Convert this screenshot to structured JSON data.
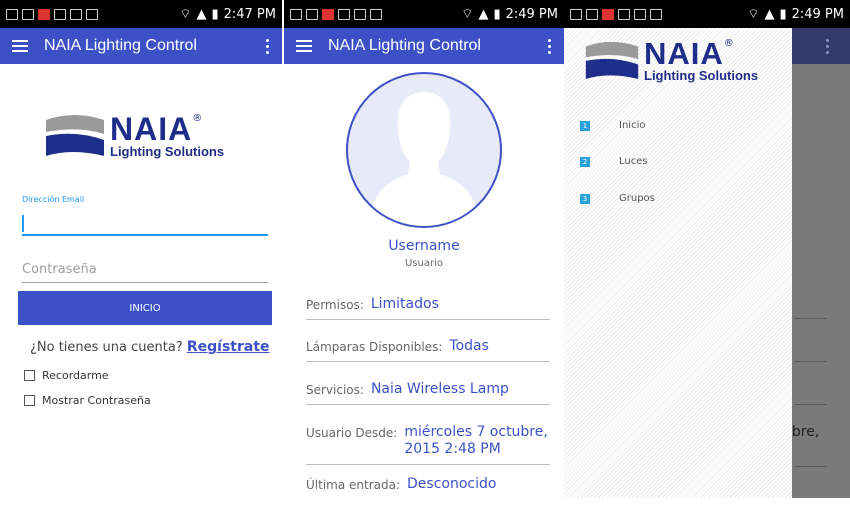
{
  "status": [
    {
      "time": "2:47 PM"
    },
    {
      "time": "2:49 PM"
    },
    {
      "time": "2:49 PM"
    }
  ],
  "appbar": {
    "title": "NAIA Lighting Control"
  },
  "logo": {
    "name": "NAIA",
    "tagline": "Lighting Solutions",
    "registered": "®"
  },
  "login": {
    "email_label": "Dirección Email",
    "email_value": "",
    "password_placeholder": "Contraseña",
    "submit_label": "INICIO",
    "signup_prompt": "¿No tienes una cuenta?",
    "signup_link": "Regístrate",
    "remember_label": "Recordarme",
    "show_password_label": "Mostrar Contraseña"
  },
  "profile": {
    "username": "Username",
    "role": "Usuario",
    "rows": [
      {
        "key": "Permisos:",
        "value": "Limitados"
      },
      {
        "key": "Lámparas Disponibles:",
        "value": "Todas"
      },
      {
        "key": "Servicios:",
        "value": "Naia Wireless Lamp"
      },
      {
        "key": "Usuario Desde:",
        "value": "miércoles 7 octubre, 2015 2:48 PM"
      },
      {
        "key": "Última entrada:",
        "value": "Desconocido"
      }
    ]
  },
  "drawer": {
    "items": [
      {
        "num": "1",
        "label": "Inicio"
      },
      {
        "num": "2",
        "label": "Luces"
      },
      {
        "num": "3",
        "label": "Grupos"
      }
    ],
    "behind_text": "ubre,"
  },
  "colors": {
    "primary": "#3c51c6",
    "accent": "#2196f3",
    "logo": "#1f2e8a"
  }
}
